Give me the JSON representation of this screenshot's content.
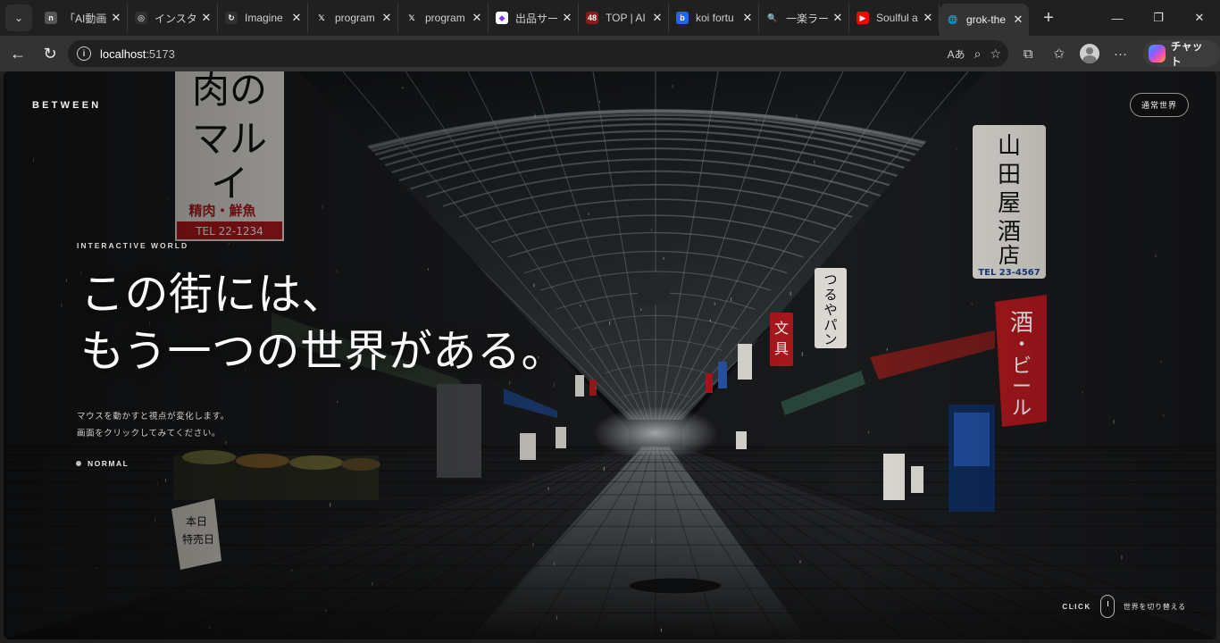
{
  "browser": {
    "tabs": [
      {
        "title": "「AI動画",
        "favicon": "n",
        "fav_color": "#555555"
      },
      {
        "title": "インスタYo",
        "favicon": "◎",
        "fav_color": "#303030"
      },
      {
        "title": "Imagine",
        "favicon": "↻",
        "fav_color": "#303030"
      },
      {
        "title": "program",
        "favicon": "𝕏",
        "fav_color": "#202020"
      },
      {
        "title": "program",
        "favicon": "𝕏",
        "fav_color": "#202020"
      },
      {
        "title": "出品サー",
        "favicon": "◆",
        "fav_color": "#ffffff"
      },
      {
        "title": "TOP | AI",
        "favicon": "48",
        "fav_color": "#8b1a1a"
      },
      {
        "title": "koi fortu",
        "favicon": "b",
        "fav_color": "#2563eb"
      },
      {
        "title": "一楽ラー",
        "favicon": "🔍",
        "fav_color": "#202020"
      },
      {
        "title": "Soulful a",
        "favicon": "▶",
        "fav_color": "#ff0000"
      },
      {
        "title": "grok-the",
        "favicon": "🌐",
        "fav_color": "#333333"
      }
    ],
    "url_host": "localhost",
    "url_port": ":5173",
    "chat_label": "チャット"
  },
  "page": {
    "brand": "BETWEEN",
    "mode_button": "通常世界",
    "eyebrow": "INTERACTIVE WORLD",
    "headline_line1": "この街には、",
    "headline_line2": "もう一つの世界がある。",
    "desc_line1": "マウスを動かすと視点が変化します。",
    "desc_line2": "画面をクリックしてみてください。",
    "status_label": "NORMAL",
    "click_label": "CLICK",
    "switch_label": "世界を切り替える"
  },
  "scene_signs": {
    "left_big_lines": [
      "肉の",
      "マル",
      "イ"
    ],
    "left_sub": "精肉・鮮魚",
    "left_tel": "TEL 22-1234",
    "right_big": [
      "山",
      "田",
      "屋",
      "酒",
      "店"
    ],
    "right_tel": "TEL 23-4567",
    "tsuruya": [
      "つ",
      "る",
      "や",
      "パ",
      "ン"
    ],
    "bungu": [
      "文",
      "具"
    ],
    "sake_beer": [
      "酒",
      "・",
      "ビ",
      "ー",
      "ル"
    ],
    "honjitsu": [
      "本日",
      "特売日"
    ]
  },
  "colors": {
    "accent_red": "#b3191f",
    "sign_white": "#e9e6e0"
  }
}
